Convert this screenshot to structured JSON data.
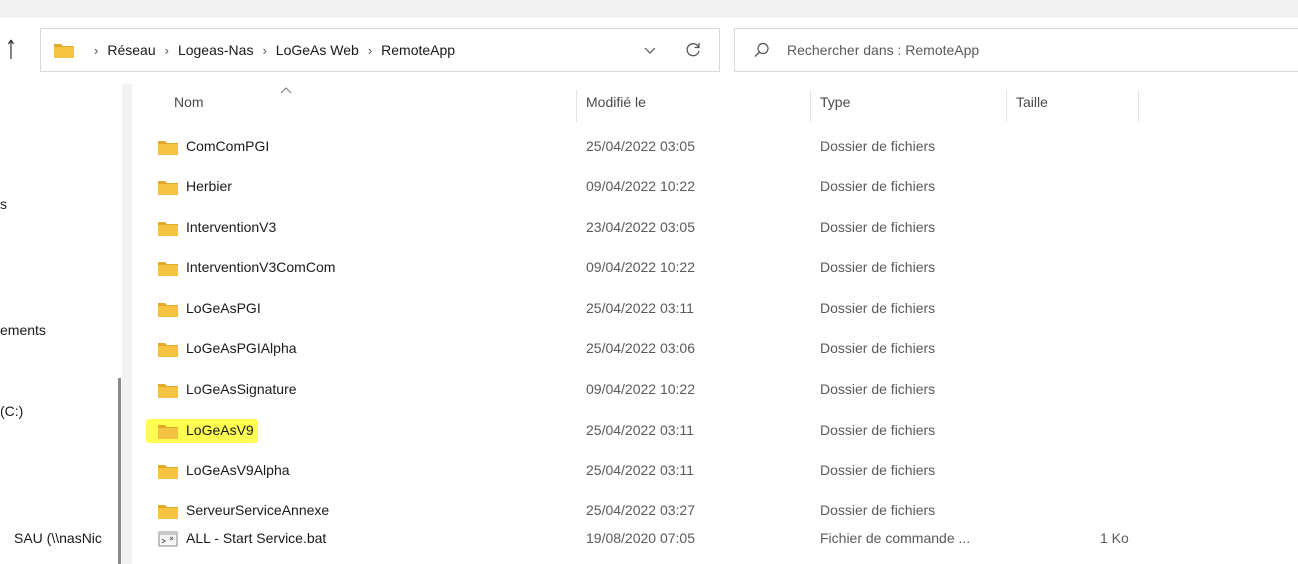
{
  "address_bar": {
    "crumbs": [
      "Réseau",
      "Logeas-Nas",
      "LoGeAs Web",
      "RemoteApp"
    ]
  },
  "search": {
    "placeholder": "Rechercher dans : RemoteApp"
  },
  "nav_pane": {
    "items": [
      "s",
      "ements",
      "(C:)",
      "SAU (\\\\nasNic"
    ]
  },
  "columns": {
    "name": "Nom",
    "modified": "Modifié le",
    "type": "Type",
    "size": "Taille"
  },
  "files": [
    {
      "name": "ComComPGI",
      "modified": "25/04/2022 03:05",
      "type": "Dossier de fichiers",
      "size": "",
      "kind": "folder"
    },
    {
      "name": "Herbier",
      "modified": "09/04/2022 10:22",
      "type": "Dossier de fichiers",
      "size": "",
      "kind": "folder"
    },
    {
      "name": "InterventionV3",
      "modified": "23/04/2022 03:05",
      "type": "Dossier de fichiers",
      "size": "",
      "kind": "folder"
    },
    {
      "name": "InterventionV3ComCom",
      "modified": "09/04/2022 10:22",
      "type": "Dossier de fichiers",
      "size": "",
      "kind": "folder"
    },
    {
      "name": "LoGeAsPGI",
      "modified": "25/04/2022 03:11",
      "type": "Dossier de fichiers",
      "size": "",
      "kind": "folder"
    },
    {
      "name": "LoGeAsPGIAlpha",
      "modified": "25/04/2022 03:06",
      "type": "Dossier de fichiers",
      "size": "",
      "kind": "folder"
    },
    {
      "name": "LoGeAsSignature",
      "modified": "09/04/2022 10:22",
      "type": "Dossier de fichiers",
      "size": "",
      "kind": "folder"
    },
    {
      "name": "LoGeAsV9",
      "modified": "25/04/2022 03:11",
      "type": "Dossier de fichiers",
      "size": "",
      "kind": "folder",
      "highlighted": true
    },
    {
      "name": "LoGeAsV9Alpha",
      "modified": "25/04/2022 03:11",
      "type": "Dossier de fichiers",
      "size": "",
      "kind": "folder"
    },
    {
      "name": "ServeurServiceAnnexe",
      "modified": "25/04/2022 03:27",
      "type": "Dossier de fichiers",
      "size": "",
      "kind": "folder"
    },
    {
      "name": "ALL - Start Service.bat",
      "modified": "19/08/2020 07:05",
      "type": "Fichier de commande ...",
      "size": "1 Ko",
      "kind": "bat"
    }
  ],
  "colors": {
    "folder": "#f5c342",
    "folder_dark": "#e2a92a",
    "highlight": "#ffff33"
  }
}
